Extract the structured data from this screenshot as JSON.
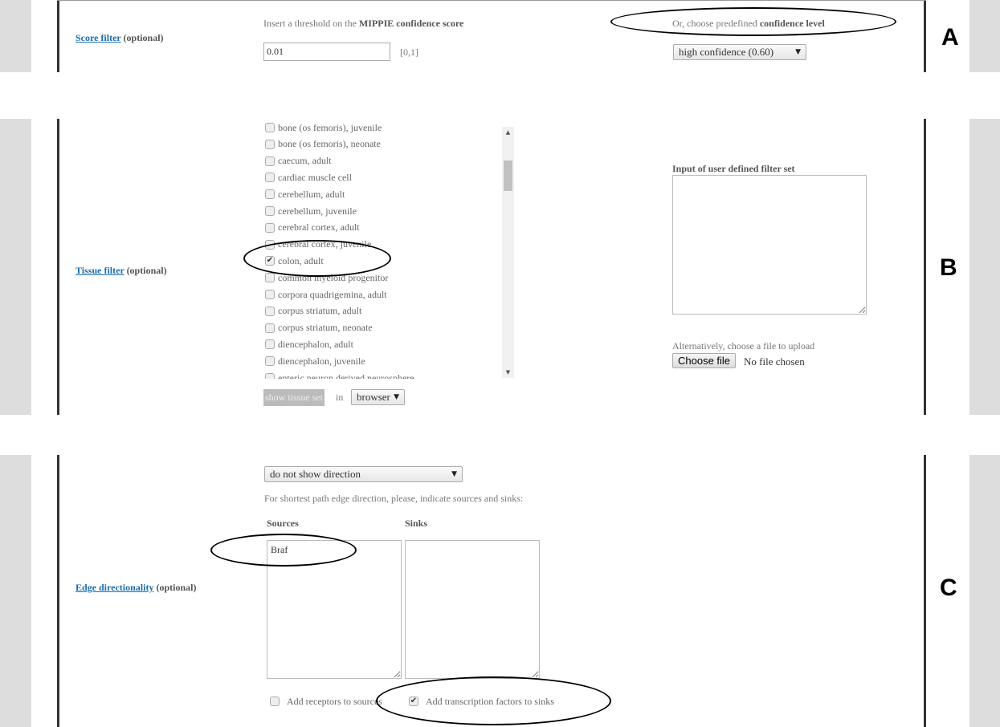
{
  "score_filter": {
    "label_link": "Score filter",
    "label_suffix": "(optional)",
    "instruction_prefix": "Insert a threshold on the ",
    "instruction_bold": "MIPPIE confidence score",
    "threshold_value": "0.01",
    "range_hint": "[0,1]",
    "predefined_prefix": "Or, choose predefined ",
    "predefined_bold": "confidence level",
    "confidence_select": "high confidence (0.60)",
    "panel_letter": "A"
  },
  "tissue_filter": {
    "label_link": "Tissue filter",
    "label_suffix": "(optional)",
    "tissues": [
      {
        "label": "bone (os femoris), juvenile",
        "checked": false
      },
      {
        "label": "bone (os femoris), neonate",
        "checked": false
      },
      {
        "label": "caecum, adult",
        "checked": false
      },
      {
        "label": "cardiac muscle cell",
        "checked": false
      },
      {
        "label": "cerebellum, adult",
        "checked": false
      },
      {
        "label": "cerebellum, juvenile",
        "checked": false
      },
      {
        "label": "cerebral cortex, adult",
        "checked": false
      },
      {
        "label": "cerebral cortex, juvenile",
        "checked": false
      },
      {
        "label": "colon, adult",
        "checked": true
      },
      {
        "label": "common myeloid progenitor",
        "checked": false
      },
      {
        "label": "corpora quadrigemina, adult",
        "checked": false
      },
      {
        "label": "corpus striatum, adult",
        "checked": false
      },
      {
        "label": "corpus striatum, neonate",
        "checked": false
      },
      {
        "label": "diencephalon, adult",
        "checked": false
      },
      {
        "label": "diencephalon, juvenile",
        "checked": false
      },
      {
        "label": "enteric neuron derived neurosphere",
        "checked": false
      }
    ],
    "show_button": "show tissue set",
    "in_label": "in",
    "target_select": "browser",
    "user_set_label": "Input of user defined filter set",
    "user_set_value": "",
    "upload_label": "Alternatively, choose a file to upload",
    "choose_file_button": "Choose file",
    "file_status": "No file chosen",
    "panel_letter": "B"
  },
  "edge_directionality": {
    "label_link": "Edge directionality",
    "label_suffix": "(optional)",
    "direction_select": "do not show direction",
    "instruction": "For shortest path edge direction, please, indicate sources and sinks:",
    "sources_label": "Sources",
    "sinks_label": "Sinks",
    "sources_value": "Braf",
    "sinks_value": "",
    "add_receptors_label": "Add receptors to sources",
    "add_receptors_checked": false,
    "add_tf_label": "Add transcription factors to sinks",
    "add_tf_checked": true,
    "panel_letter": "C"
  }
}
